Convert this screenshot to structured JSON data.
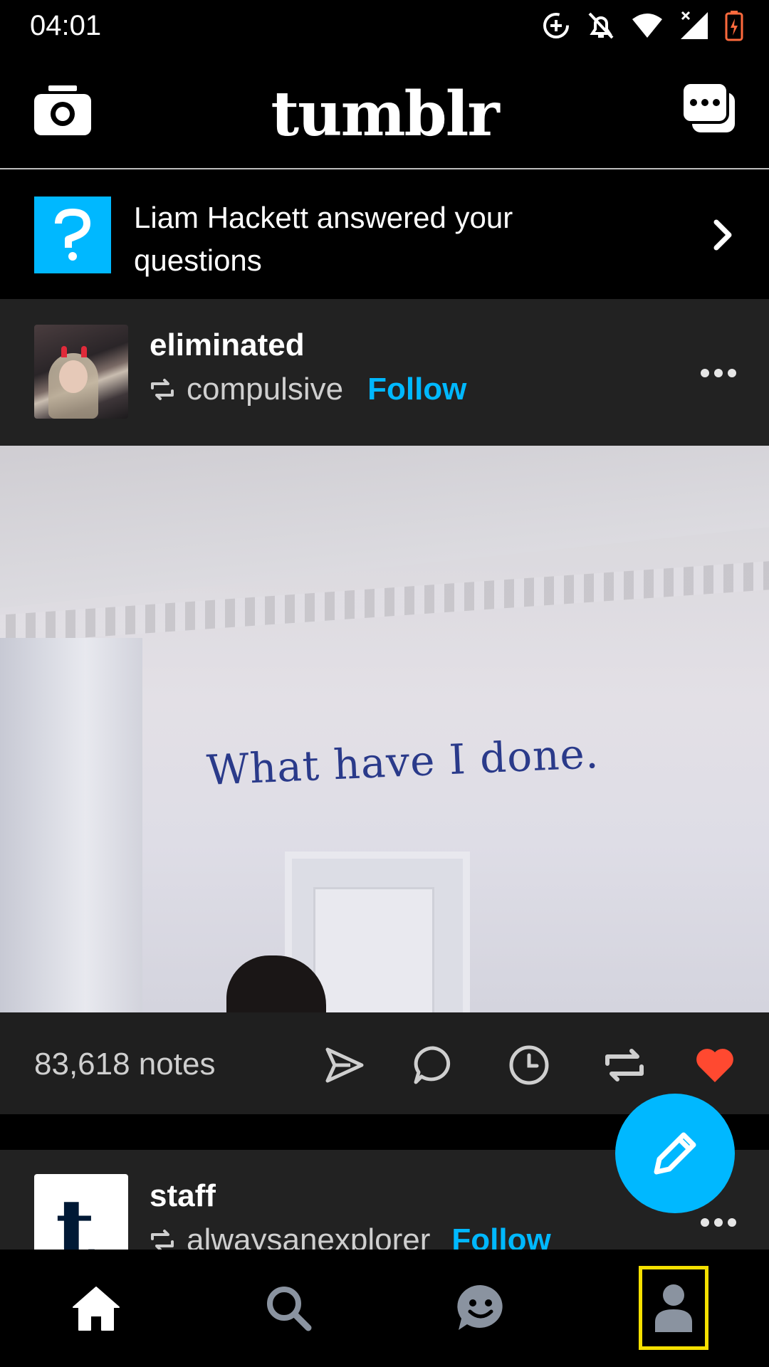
{
  "status_bar": {
    "time": "04:01"
  },
  "header": {
    "logo_text": "tumblr",
    "camera_icon": "camera-icon",
    "messages_icon": "messages-icon"
  },
  "notification": {
    "text": "Liam Hackett answered your questions",
    "icon": "question-icon",
    "icon_color": "#00b8ff"
  },
  "post": {
    "blog_name": "eliminated",
    "reblogged_from": "compulsive",
    "follow_label": "Follow",
    "image_text": "What have I done.",
    "notes": "83,618 notes",
    "liked": true,
    "like_color": "#ff4930"
  },
  "post2": {
    "blog_name": "staff",
    "reblogged_from": "alwaysanexplorer",
    "follow_label": "Follow",
    "avatar_letter": "t"
  },
  "bottom_nav": {
    "items": [
      "home-icon",
      "search-icon",
      "activity-icon",
      "account-icon"
    ],
    "selected": "account-icon"
  },
  "colors": {
    "accent": "#00b8ff",
    "background": "#000000",
    "card": "#1f1f1f",
    "highlight": "#f5e000"
  }
}
